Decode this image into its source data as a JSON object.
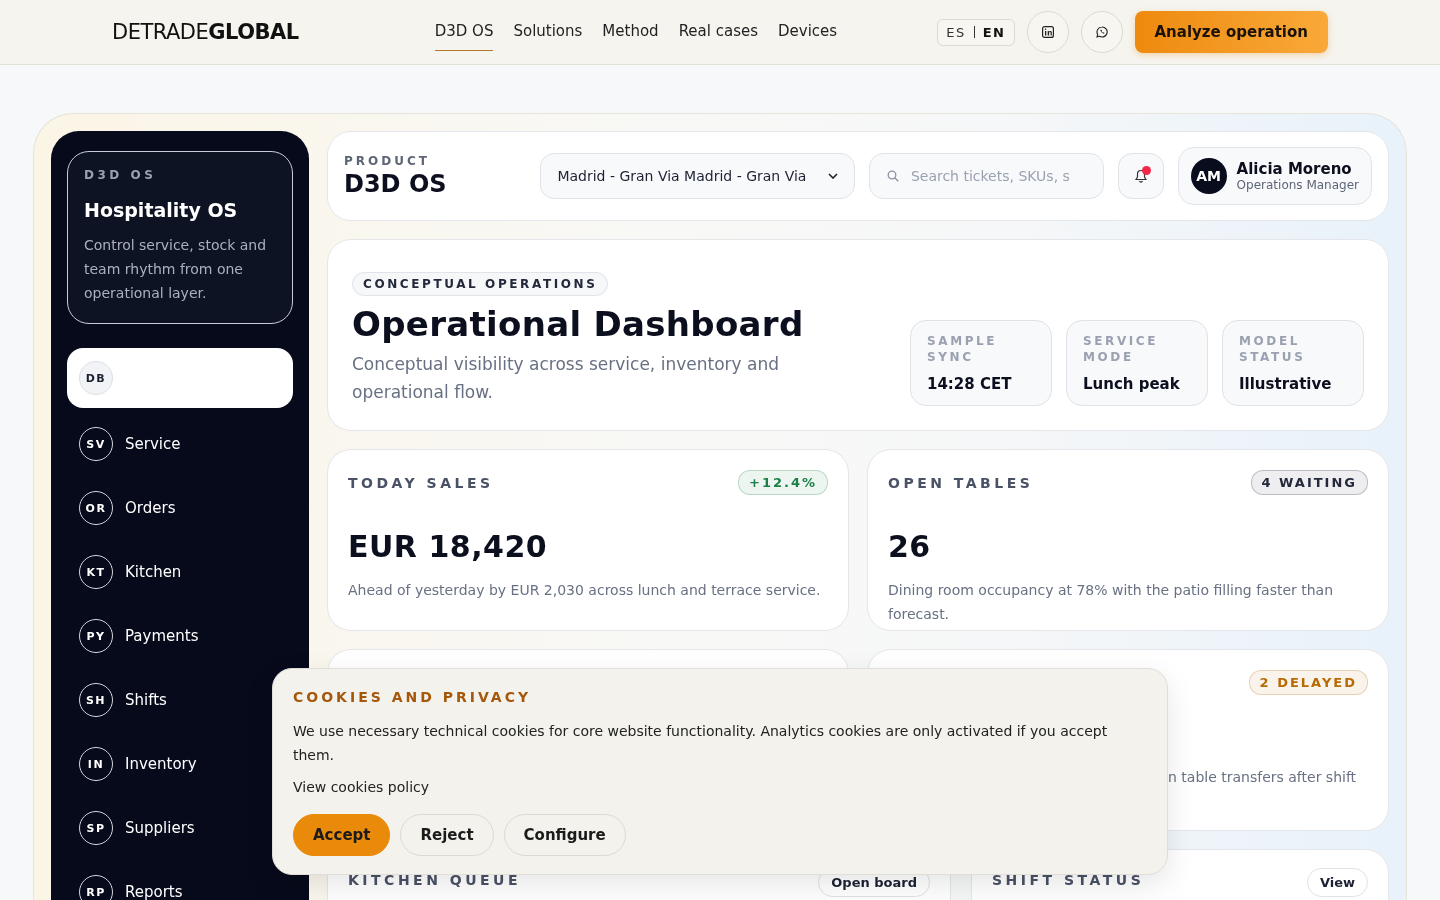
{
  "header": {
    "logo_light": "DETRADE",
    "logo_bold": "GLOBAL",
    "nav": [
      {
        "label": "D3D OS",
        "selected": true
      },
      {
        "label": "Solutions",
        "selected": false
      },
      {
        "label": "Method",
        "selected": false
      },
      {
        "label": "Real cases",
        "selected": false
      },
      {
        "label": "Devices",
        "selected": false
      }
    ],
    "languages": [
      {
        "label": "ES",
        "selected": false
      },
      {
        "label": "EN",
        "selected": true
      }
    ],
    "cta": "Analyze operation"
  },
  "sidebar": {
    "eyebrow": "D3D OS",
    "title": "Hospitality OS",
    "description": "Control service, stock and team rhythm from one operational layer.",
    "items": [
      {
        "code": "DB",
        "selected": true
      },
      {
        "code": "SV",
        "label": "Service",
        "selected": false
      },
      {
        "code": "OR",
        "label": "Orders",
        "selected": false
      },
      {
        "code": "KT",
        "label": "Kitchen",
        "selected": false
      },
      {
        "code": "PY",
        "label": "Payments",
        "selected": false
      },
      {
        "code": "SH",
        "label": "Shifts",
        "selected": false
      },
      {
        "code": "IN",
        "label": "Inventory",
        "selected": false
      },
      {
        "code": "SP",
        "label": "Suppliers",
        "selected": false
      },
      {
        "code": "RP",
        "label": "Reports",
        "selected": false
      }
    ]
  },
  "topbar": {
    "eyebrow": "PRODUCT",
    "title": "D3D OS",
    "location": "Madrid - Gran Via Madrid - Gran Via",
    "search": {
      "placeholder": "Search tickets, SKUs, s"
    },
    "notifications": {
      "unread": true
    },
    "user": {
      "initials": "AM",
      "name": "Alicia Moreno",
      "role": "Operations Manager"
    }
  },
  "hero": {
    "badge": "CONCEPTUAL OPERATIONS",
    "title": "Operational Dashboard",
    "subtitle": "Conceptual visibility across service, inventory and operational flow.",
    "facts": [
      {
        "label": "SAMPLE SYNC",
        "value": "14:28 CET"
      },
      {
        "label": "SERVICE MODE",
        "value": "Lunch peak"
      },
      {
        "label": "MODEL STATUS",
        "value": "Illustrative"
      }
    ]
  },
  "metrics": [
    {
      "label": "TODAY SALES",
      "badge": "+12.4%",
      "color": "#1a7f46",
      "value": "EUR 18,420",
      "note": "Ahead of yesterday by EUR 2,030 across lunch and terrace service."
    },
    {
      "label": "OPEN TABLES",
      "badge": "4 WAITING",
      "color": "#23293a",
      "value": "26",
      "note": "Dining room occupancy at 78% with the patio filling faster than forecast."
    }
  ],
  "alert_card": {
    "badge": "2 DELAYED",
    "note": "n table transfers after shift"
  },
  "panels": [
    {
      "title": "KITCHEN QUEUE",
      "action": "Open board"
    },
    {
      "title": "SHIFT STATUS",
      "action": "View"
    }
  ],
  "cookies": {
    "title": "COOKIES AND PRIVACY",
    "text": "We use necessary technical cookies for core website functionality. Analytics cookies are only activated if you accept them.",
    "link": "View cookies policy",
    "buttons": [
      {
        "label": "Accept",
        "kind": "primary"
      },
      {
        "label": "Reject",
        "kind": "secondary"
      },
      {
        "label": "Configure",
        "kind": "secondary"
      }
    ]
  }
}
